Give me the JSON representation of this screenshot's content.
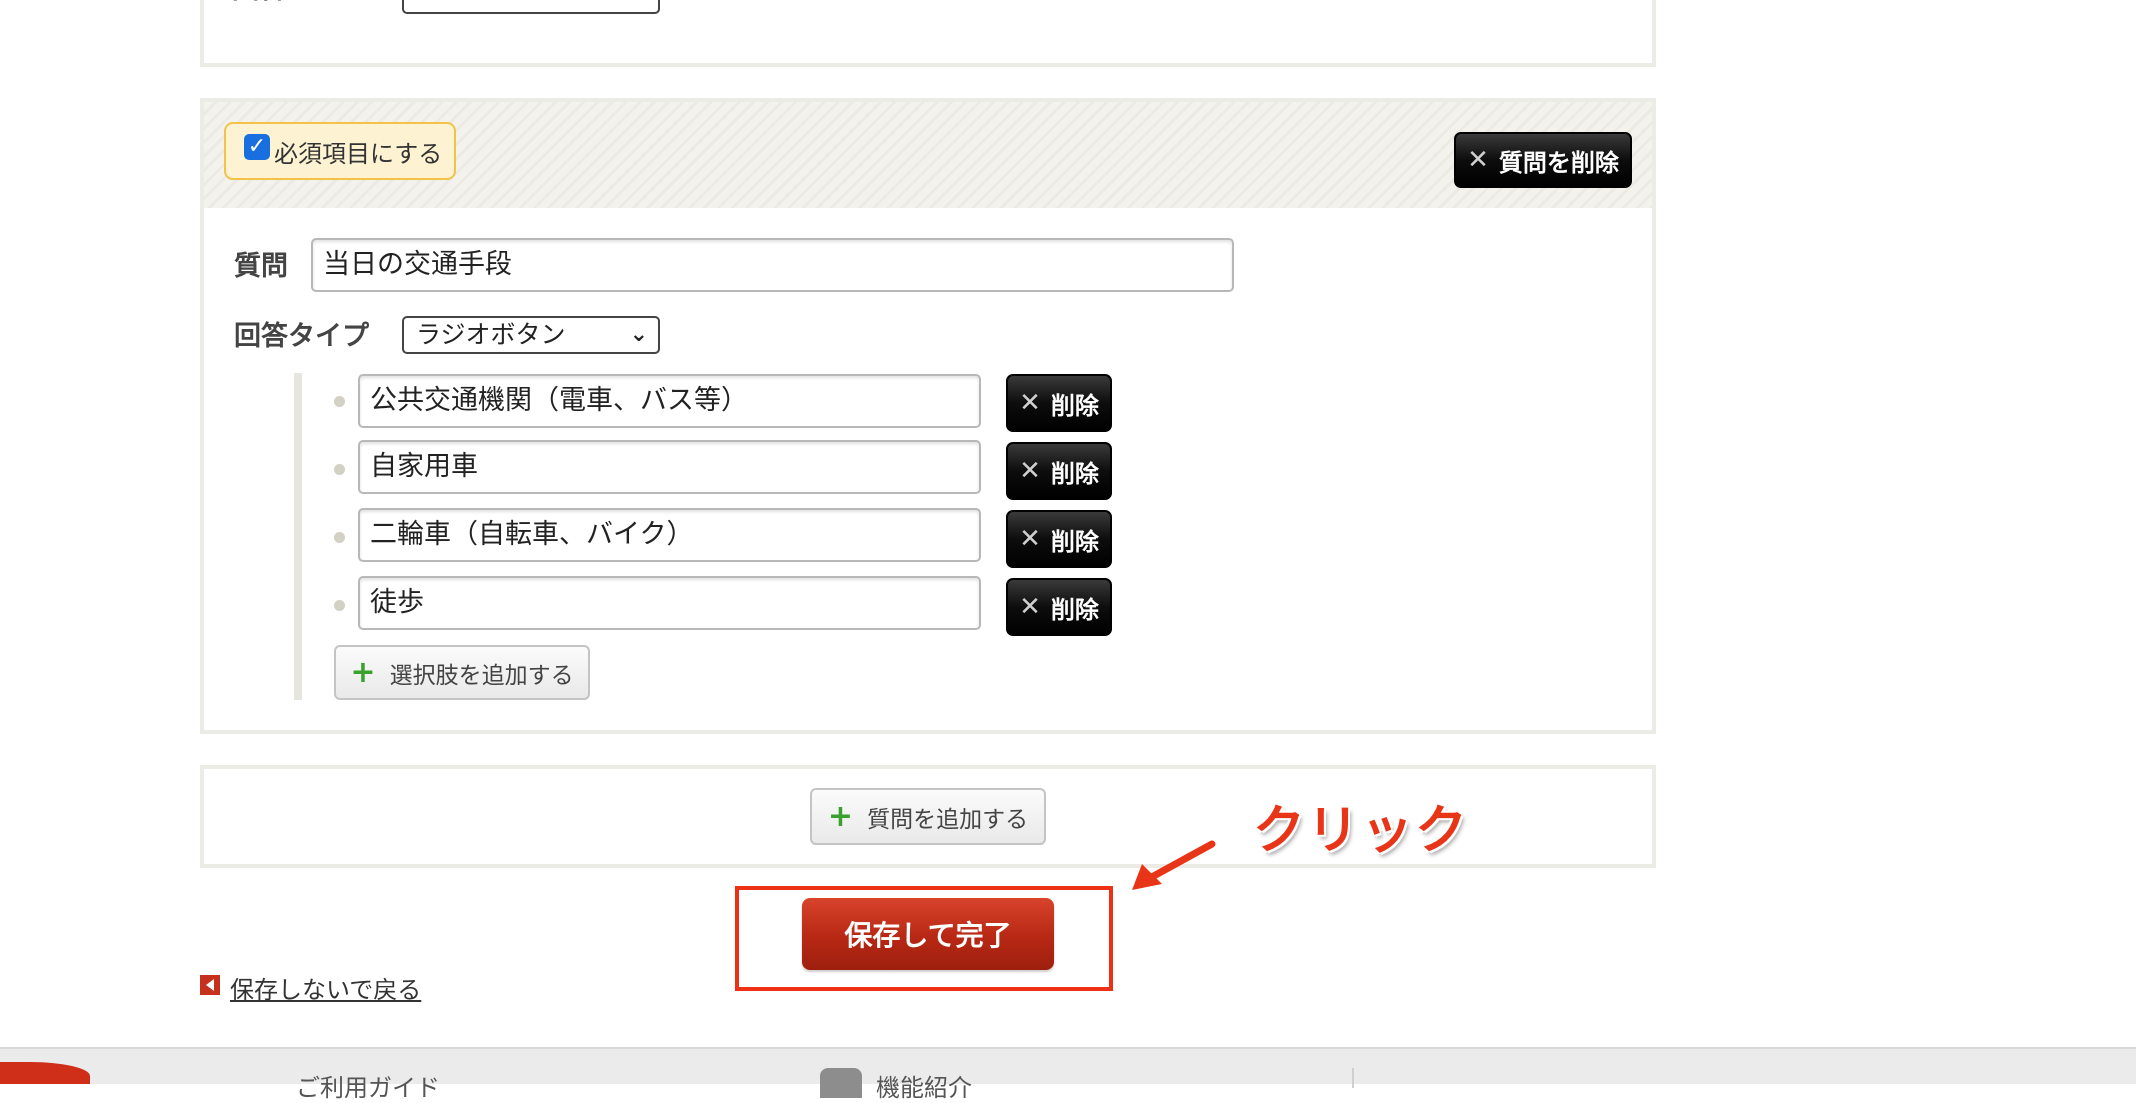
{
  "previous_question": {
    "answer_type_label": "回答タイプ"
  },
  "question": {
    "required_label": "必須項目にする",
    "required_checked": true,
    "delete_question_label": "質問を削除",
    "question_label": "質問",
    "question_value": "当日の交通手段",
    "answer_type_label": "回答タイプ",
    "answer_type_value": "ラジオボタン",
    "choices": [
      {
        "value": "公共交通機関（電車、バス等）",
        "delete_label": "削除"
      },
      {
        "value": "自家用車",
        "delete_label": "削除"
      },
      {
        "value": "二輪車（自転車、バイク）",
        "delete_label": "削除"
      },
      {
        "value": "徒歩",
        "delete_label": "削除"
      }
    ],
    "add_choice_label": "選択肢を追加する"
  },
  "add_question_label": "質問を追加する",
  "save_label": "保存して完了",
  "annotation": {
    "text": "クリック",
    "color": "#e93517"
  },
  "back_label": "保存しないで戻る",
  "footer": {
    "guide_label": "ご利用ガイド",
    "feature_label": "機能紹介"
  },
  "colors": {
    "primary_red": "#b72814",
    "checkbox_blue": "#1a6fe0",
    "plus_green": "#3aa12f"
  }
}
